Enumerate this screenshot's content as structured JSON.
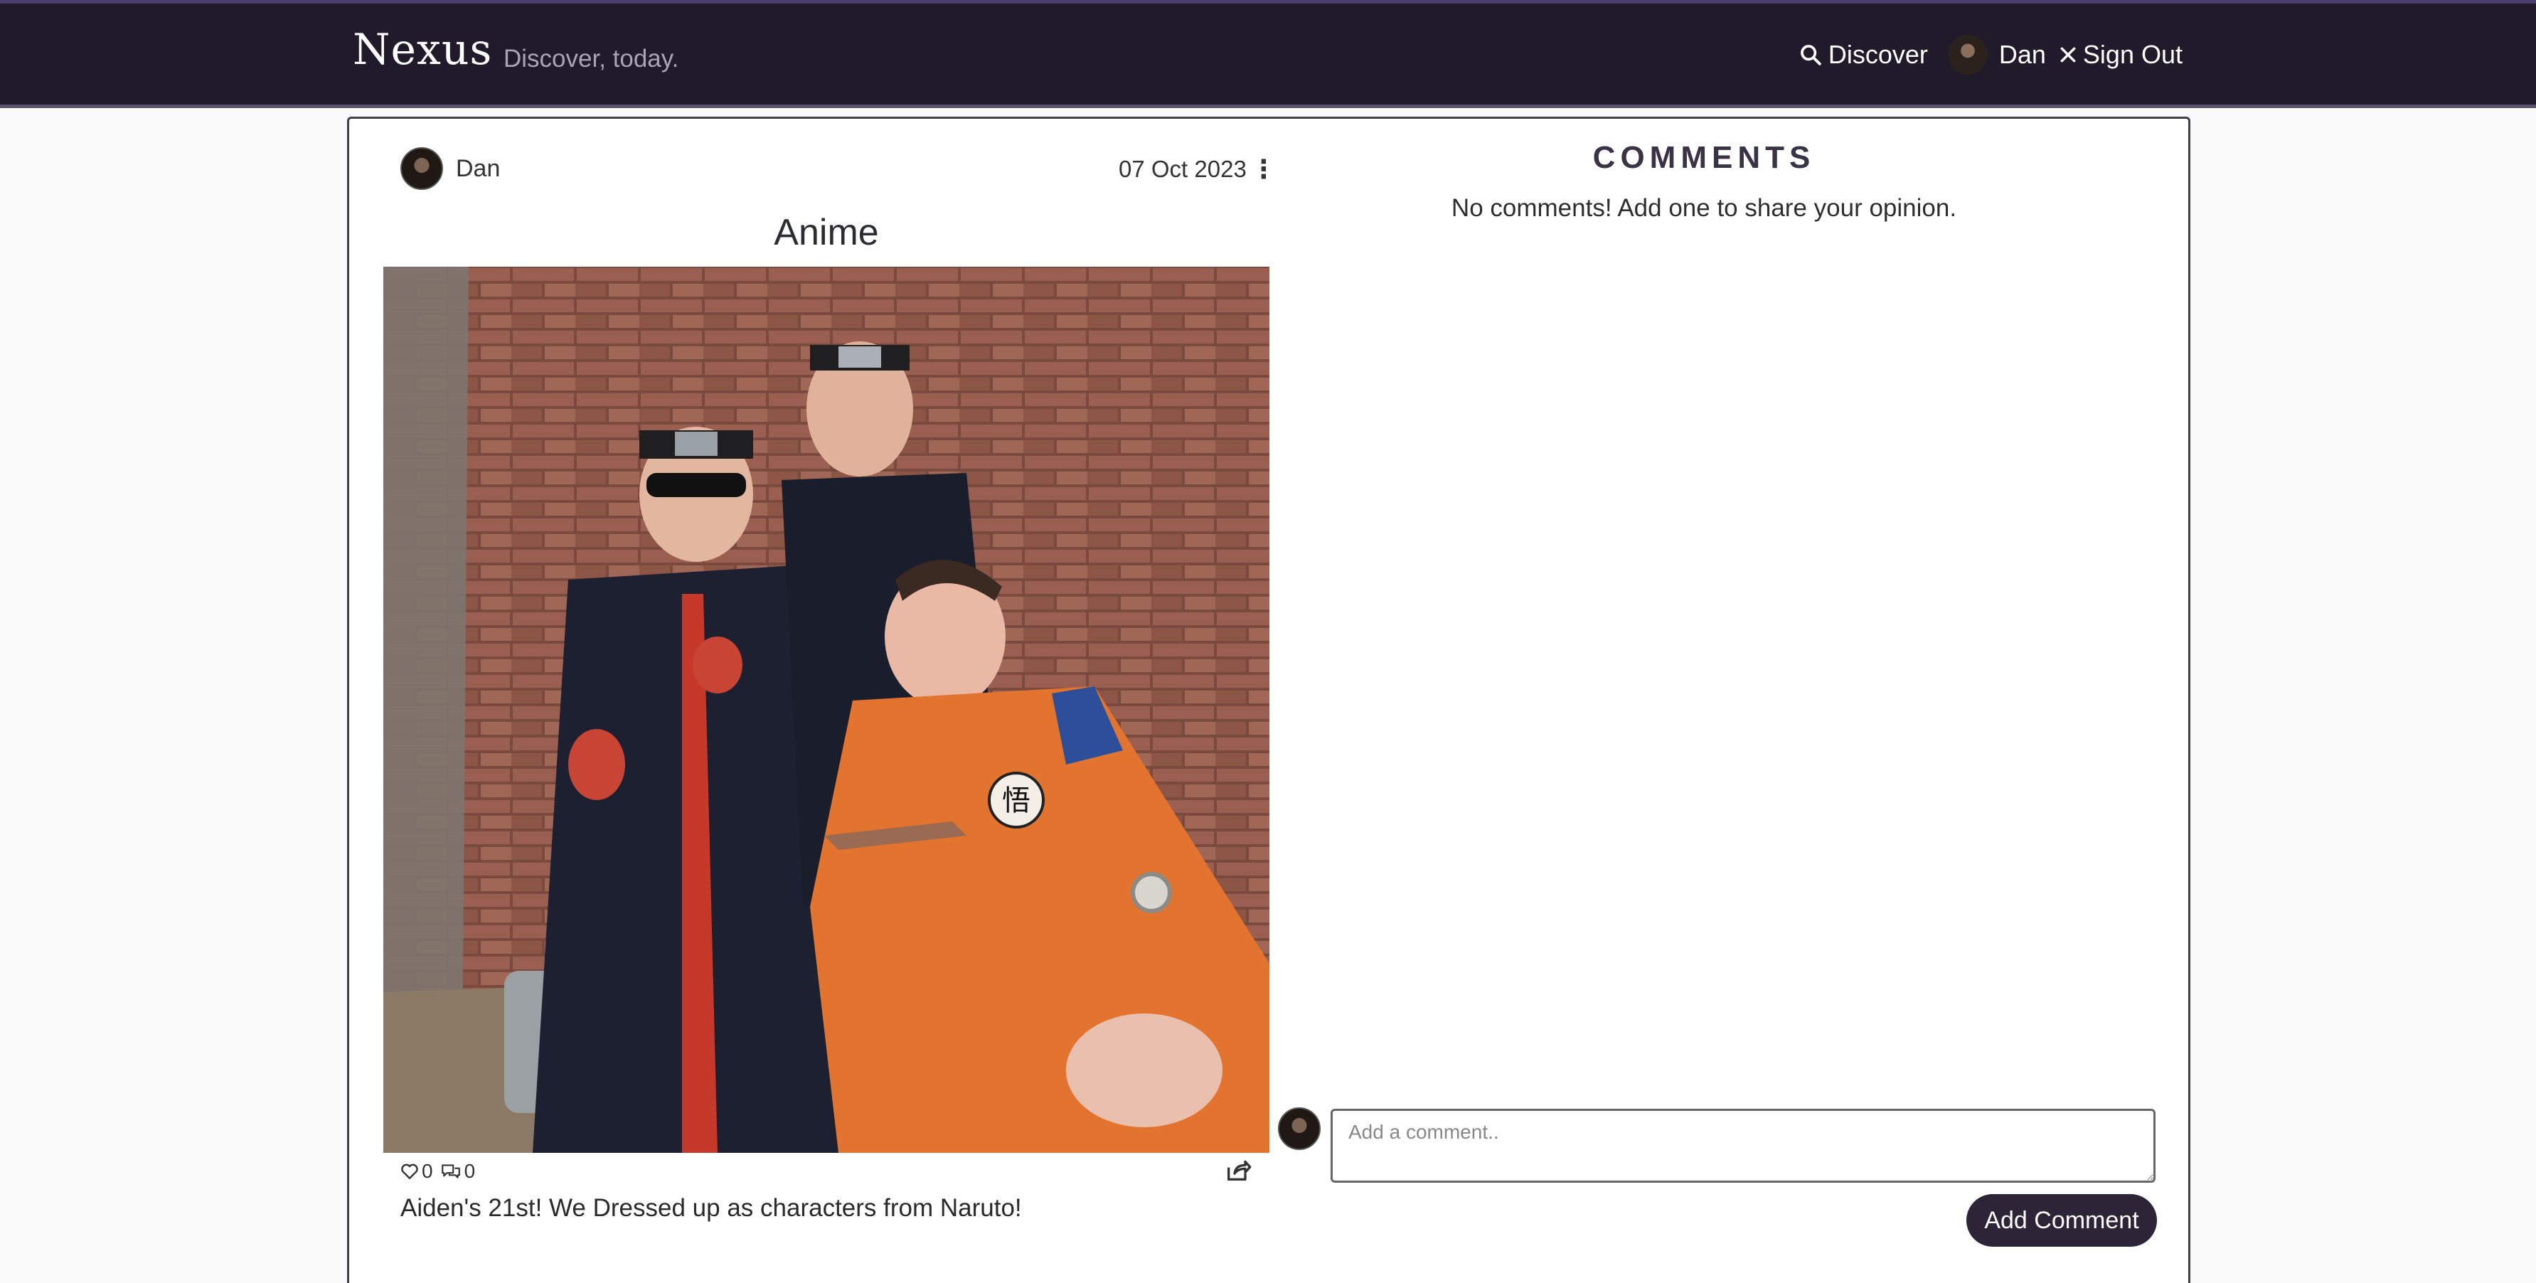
{
  "brand": {
    "name": "Nexus",
    "tagline": "Discover, today."
  },
  "nav": {
    "discover": "Discover",
    "user": "Dan",
    "sign_out": "Sign Out"
  },
  "post": {
    "author": "Dan",
    "date": "07 Oct 2023",
    "title": "Anime",
    "likes": "0",
    "comments_count": "0",
    "caption": "Aiden's 21st! We Dressed up as characters from Naruto!"
  },
  "comments": {
    "heading": "COMMENTS",
    "empty_text": "No comments! Add one to share your opinion.",
    "input_placeholder": "Add a comment..",
    "submit_label": "Add Comment"
  },
  "colors": {
    "navbar": "#201a2b",
    "accent": "#2d2438"
  },
  "icons": [
    "search-icon",
    "close-icon",
    "heart-icon",
    "comment-icon",
    "share-icon",
    "more-options-icon"
  ]
}
